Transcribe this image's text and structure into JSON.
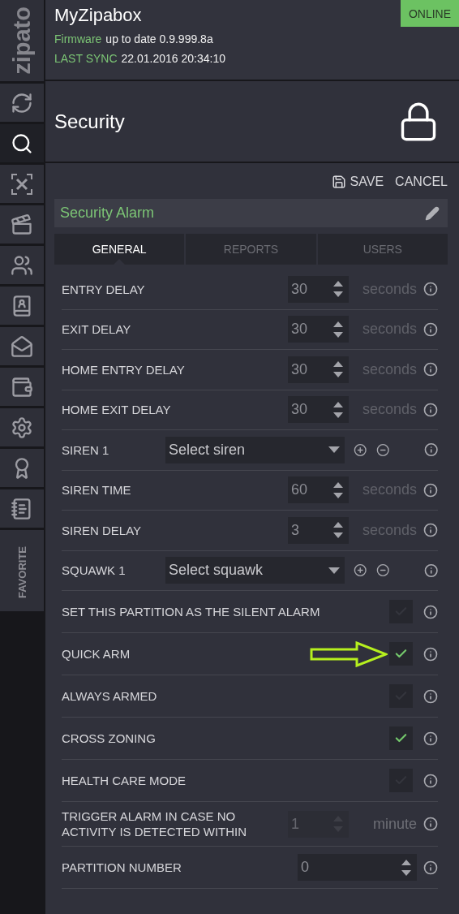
{
  "sidebar": {
    "logo": "zipato",
    "items": [
      {
        "selected": false
      },
      {
        "selected": true
      },
      {
        "selected": false
      },
      {
        "selected": false
      },
      {
        "selected": false
      },
      {
        "selected": false
      },
      {
        "selected": false
      },
      {
        "selected": false
      },
      {
        "selected": false
      },
      {
        "selected": false
      },
      {
        "selected": false
      },
      {
        "selected": false,
        "label": "FAVORITE"
      }
    ]
  },
  "header": {
    "title": "MyZipabox",
    "status": "ONLINE",
    "firmware_label": "Firmware",
    "firmware_value": "up to date 0.9.999.8a",
    "sync_label": "LAST SYNC",
    "sync_value": "22.01.2016 20:34:10"
  },
  "section": {
    "title": "Security"
  },
  "toolbar": {
    "save": "SAVE",
    "cancel": "CANCEL"
  },
  "panel": {
    "title": "Security Alarm"
  },
  "tabs": [
    {
      "label": "GENERAL",
      "selected": true
    },
    {
      "label": "REPORTS",
      "selected": false
    },
    {
      "label": "USERS",
      "selected": false
    }
  ],
  "rows": [
    {
      "kind": "number",
      "label": "ENTRY DELAY",
      "value": "30",
      "unit": "seconds",
      "disabled": false
    },
    {
      "kind": "number",
      "label": "EXIT DELAY",
      "value": "30",
      "unit": "seconds",
      "disabled": false
    },
    {
      "kind": "number",
      "label": "HOME ENTRY DELAY",
      "value": "30",
      "unit": "seconds",
      "disabled": false
    },
    {
      "kind": "number",
      "label": "HOME EXIT DELAY",
      "value": "30",
      "unit": "seconds",
      "disabled": false
    },
    {
      "kind": "select",
      "label": "SIREN 1",
      "placeholder": "Select siren"
    },
    {
      "kind": "number",
      "label": "SIREN TIME",
      "value": "60",
      "unit": "seconds",
      "disabled": false
    },
    {
      "kind": "number",
      "label": "SIREN DELAY",
      "value": "3",
      "unit": "seconds",
      "disabled": false
    },
    {
      "kind": "select",
      "label": "SQUAWK 1",
      "placeholder": "Select squawk"
    },
    {
      "kind": "checkbox",
      "label": "SET THIS PARTITION AS THE SILENT ALARM",
      "checked": false,
      "annotated": false
    },
    {
      "kind": "checkbox",
      "label": "QUICK ARM",
      "checked": true,
      "annotated": true
    },
    {
      "kind": "checkbox",
      "label": "ALWAYS ARMED",
      "checked": false,
      "annotated": false
    },
    {
      "kind": "checkbox",
      "label": "CROSS ZONING",
      "checked": true,
      "annotated": false
    },
    {
      "kind": "checkbox",
      "label": "HEALTH CARE MODE",
      "checked": false,
      "annotated": false
    },
    {
      "kind": "number",
      "label": "TRIGGER ALARM IN CASE NO ACTIVITY IS DETECTED WITHIN",
      "value": "1",
      "unit": "minute",
      "disabled": true
    },
    {
      "kind": "wide-number",
      "label": "PARTITION NUMBER",
      "value": "0"
    }
  ]
}
